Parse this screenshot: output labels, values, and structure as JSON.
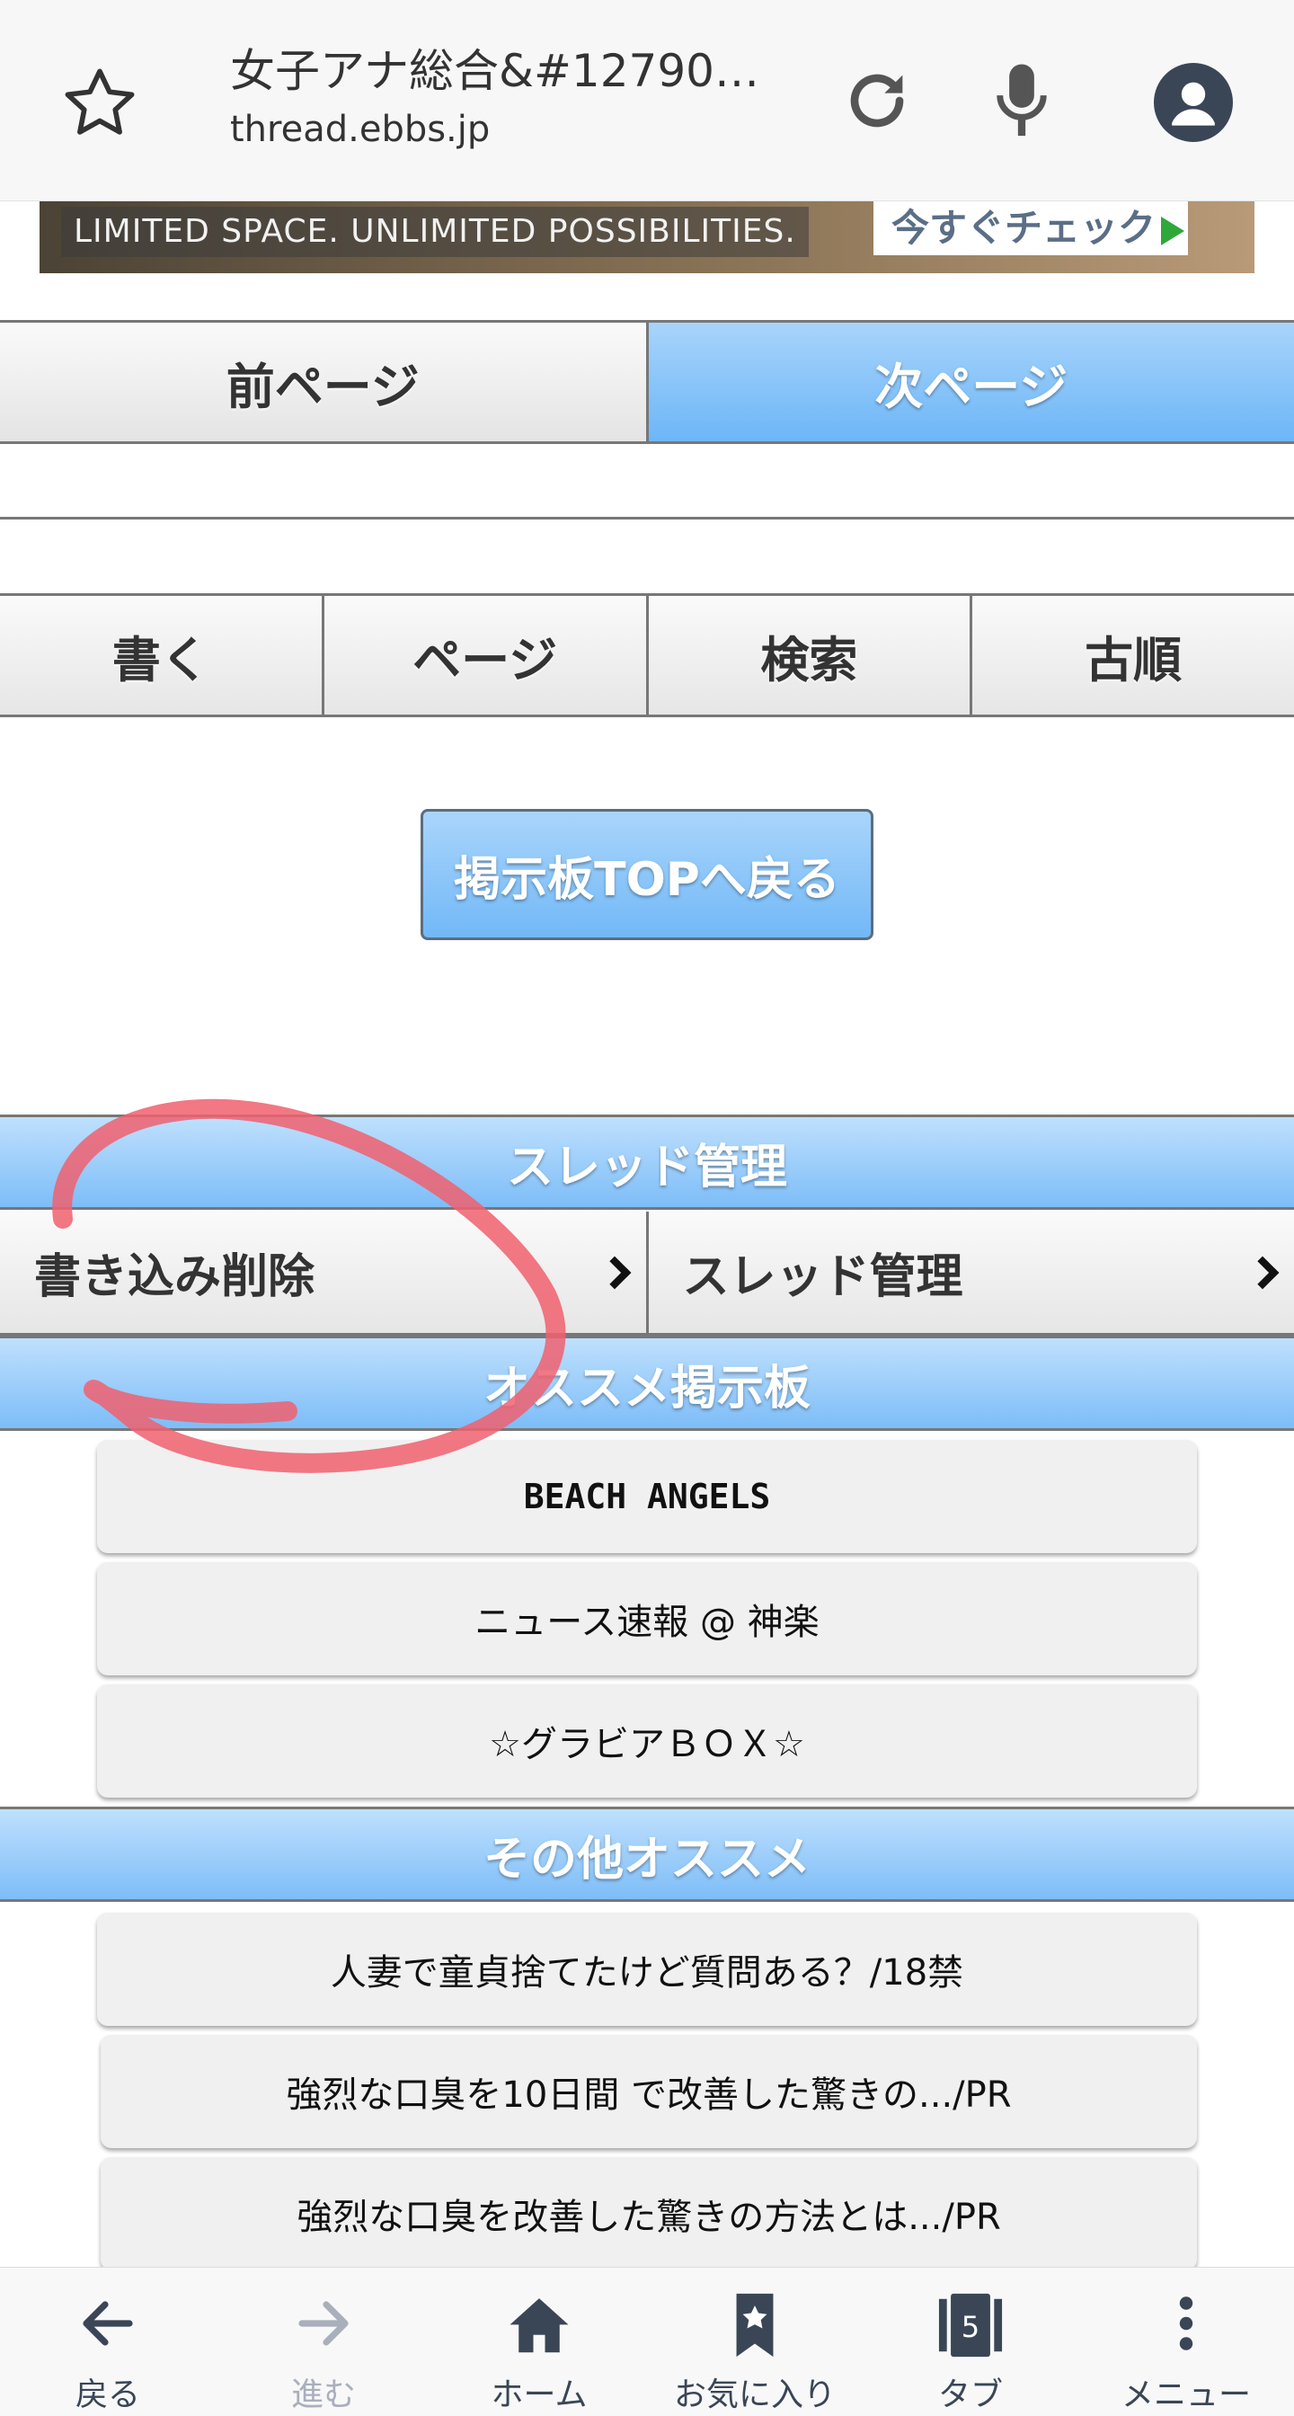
{
  "browser": {
    "title": "女子アナ総合&#127908;...",
    "url": "thread.ebbs.jp",
    "icons": [
      "star-icon",
      "reload-icon",
      "mic-icon",
      "account-icon"
    ]
  },
  "ad": {
    "text": "LIMITED SPACE. UNLIMITED POSSIBILITIES.",
    "cta": "今すぐチェック"
  },
  "pager": {
    "prev": "前ページ",
    "next": "次ページ"
  },
  "actions": [
    "書く",
    "ページ",
    "検索",
    "古順"
  ],
  "back_top": "掲示板TOPへ戻る",
  "thread_manage": {
    "header": "スレッド管理",
    "items": [
      "書き込み削除",
      "スレッド管理"
    ]
  },
  "recommended": {
    "header": "オススメ掲示板",
    "items": [
      "BEACH ANGELS",
      "ニュース速報 @ 神楽",
      "☆グラビアＢＯＸ☆"
    ]
  },
  "other": {
    "header": "その他オススメ",
    "items": [
      "人妻で童貞捨てたけど質問ある？/18禁",
      "強烈な口臭を10日間 で改善した驚きの.../PR",
      "強烈な口臭を改善した驚きの方法とは.../PR"
    ]
  },
  "bottom_nav": {
    "back": "戻る",
    "forward": "進む",
    "home": "ホーム",
    "favorites": "お気に入り",
    "tabs": "タブ",
    "tab_count": "5",
    "menu": "メニュー"
  },
  "colors": {
    "accent_blue": "#7dbdf8",
    "annotation_red": "#f0606e",
    "icon_dark": "#3a4656"
  }
}
